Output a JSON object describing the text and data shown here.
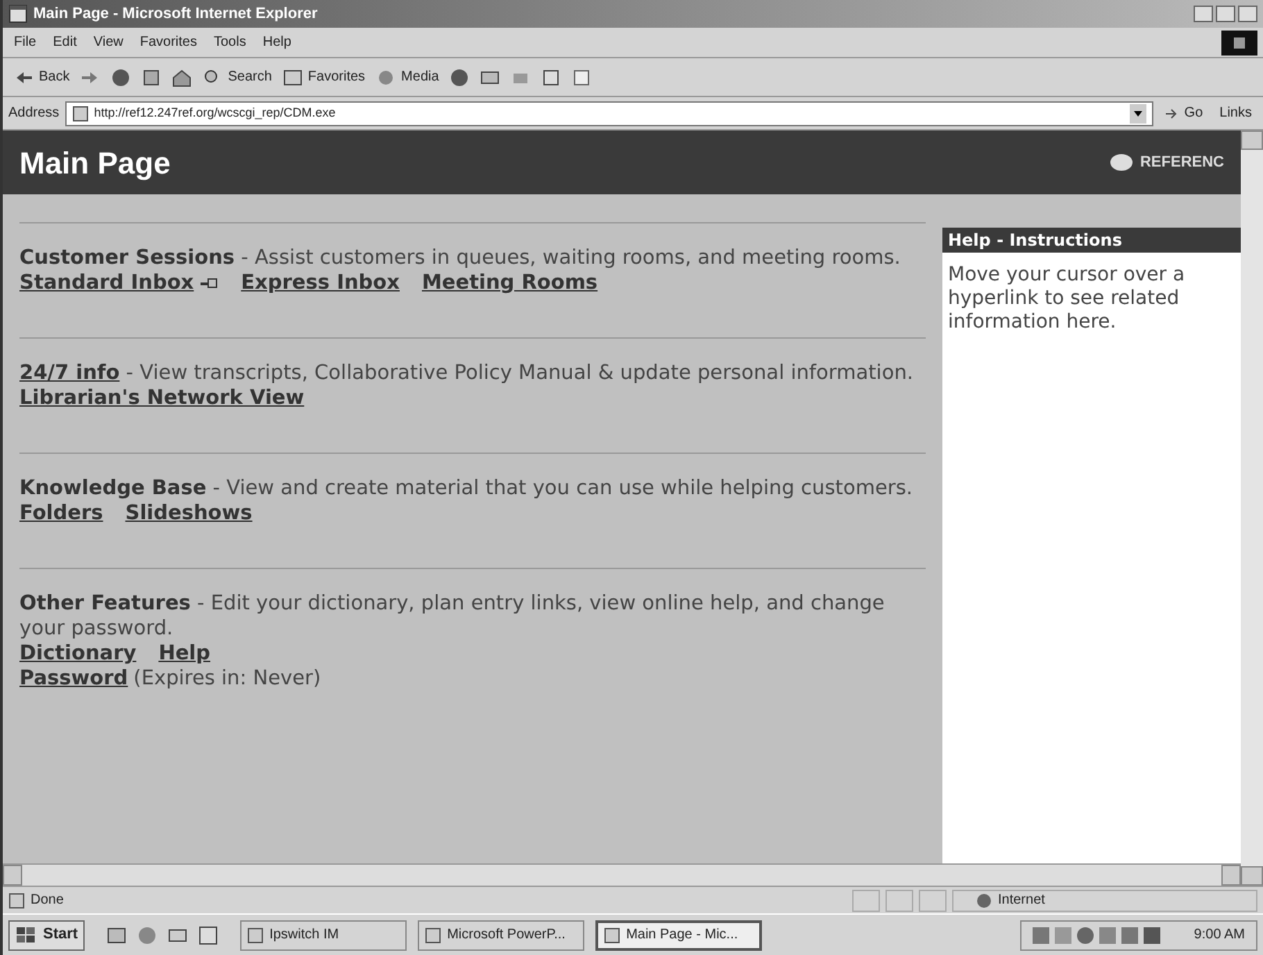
{
  "window": {
    "title": "Main Page - Microsoft Internet Explorer"
  },
  "menu": [
    "File",
    "Edit",
    "View",
    "Favorites",
    "Tools",
    "Help"
  ],
  "toolbar": [
    {
      "kind": "back",
      "label": "Back"
    },
    {
      "kind": "forward"
    },
    {
      "kind": "stop"
    },
    {
      "kind": "refresh"
    },
    {
      "kind": "home"
    },
    {
      "kind": "search",
      "label": "Search"
    },
    {
      "kind": "favorites",
      "label": "Favorites"
    },
    {
      "kind": "media",
      "label": "Media"
    },
    {
      "kind": "history"
    },
    {
      "kind": "mail"
    },
    {
      "kind": "print"
    },
    {
      "kind": "edit"
    },
    {
      "kind": "discuss"
    }
  ],
  "address_bar": {
    "label": "Address",
    "url": "http://ref12.247ref.org/wcscgi_rep/CDM.exe",
    "go": "Go",
    "links": "Links"
  },
  "page": {
    "title": "Main Page",
    "logo": "REFERENC",
    "sections": [
      {
        "heading": "Customer Sessions",
        "heading_is_link": false,
        "description": " - Assist customers in queues, waiting rooms, and meeting rooms.",
        "lines": [
          [
            {
              "text": "Standard Inbox",
              "kind": "link",
              "icon": true
            },
            {
              "text": "Express Inbox",
              "kind": "link"
            },
            {
              "text": "Meeting Rooms",
              "kind": "link"
            }
          ]
        ]
      },
      {
        "heading": "24/7 info",
        "heading_is_link": true,
        "description": " - View transcripts, Collaborative Policy Manual & update personal information.",
        "lines": [
          [
            {
              "text": "Librarian's Network View",
              "kind": "link"
            }
          ]
        ]
      },
      {
        "heading": "Knowledge Base",
        "heading_is_link": false,
        "description": " - View and create material that you can use while helping customers.",
        "lines": [
          [
            {
              "text": "Folders",
              "kind": "link"
            },
            {
              "text": "Slideshows",
              "kind": "link"
            }
          ]
        ]
      },
      {
        "heading": "Other Features",
        "heading_is_link": false,
        "description": " - Edit your dictionary, plan entry links, view online help, and change your password.",
        "lines": [
          [
            {
              "text": "Dictionary",
              "kind": "link"
            },
            {
              "text": "Help",
              "kind": "link"
            }
          ],
          [
            {
              "text": "Password",
              "kind": "link"
            },
            {
              "text": "(Expires in: Never)",
              "kind": "note"
            }
          ]
        ]
      }
    ],
    "help": {
      "title": "Help - Instructions",
      "text": "Move your cursor over a hyperlink to see related information here."
    }
  },
  "status_bar": {
    "text": "Done",
    "zone": "Internet"
  },
  "taskbar": {
    "start": "Start",
    "tasks": [
      {
        "label": "Ipswitch IM",
        "selected": false
      },
      {
        "label": "Microsoft PowerP...",
        "selected": false
      },
      {
        "label": "Main Page - Mic...",
        "selected": true
      }
    ],
    "clock": "9:00 AM"
  }
}
